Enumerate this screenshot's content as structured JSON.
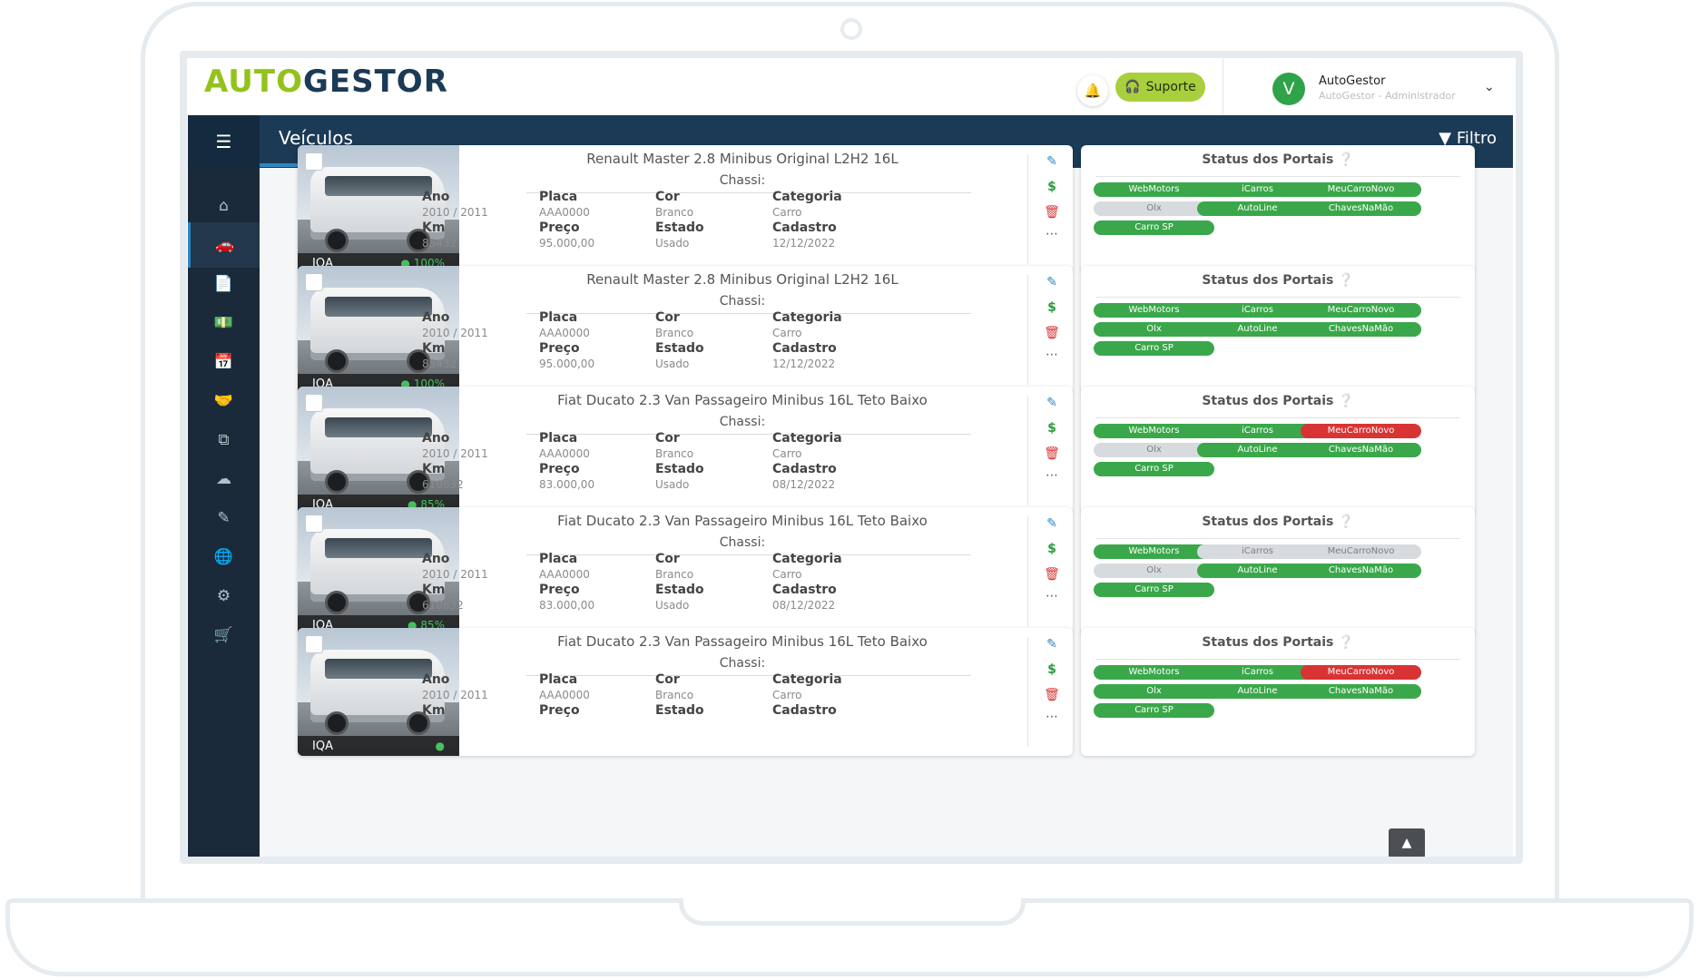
{
  "app": {
    "logo_a": "AUTO",
    "logo_b": "GESTOR"
  },
  "header": {
    "suporte_label": "Suporte",
    "user_initial": "V",
    "user_name": "AutoGestor",
    "user_role": "AutoGestor - Administrador"
  },
  "nav": {
    "page_title": "Veículos",
    "filter_label": "Filtro"
  },
  "sidebar": {
    "items": [
      "home",
      "vehicles",
      "documents",
      "finance",
      "calendar",
      "deals",
      "copy",
      "cloud-upload",
      "edit",
      "globe",
      "settings",
      "cart"
    ],
    "active": "vehicles"
  },
  "labels": {
    "chassi": "Chassi:",
    "ano": "Ano",
    "placa": "Placa",
    "cor": "Cor",
    "categoria": "Categoria",
    "km": "Km",
    "preco": "Preço",
    "estado": "Estado",
    "cadastro": "Cadastro",
    "iqa": "IQA",
    "status_title": "Status dos Portais"
  },
  "vehicles": [
    {
      "title": "Renault Master 2.8 Minibus Original L2H2 16L",
      "ano": "2010 / 2011",
      "placa": "AAA0000",
      "cor": "Branco",
      "categoria": "Carro",
      "km": "85432",
      "preco": "95.000,00",
      "estado": "Usado",
      "cadastro": "12/12/2022",
      "iqa": "100%"
    },
    {
      "title": "Renault Master 2.8 Minibus Original L2H2 16L",
      "ano": "2010 / 2011",
      "placa": "AAA0000",
      "cor": "Branco",
      "categoria": "Carro",
      "km": "85432",
      "preco": "95.000,00",
      "estado": "Usado",
      "cadastro": "12/12/2022",
      "iqa": "100%"
    },
    {
      "title": "Fiat Ducato 2.3 Van Passageiro Minibus 16L Teto Baixo",
      "ano": "2010 / 2011",
      "placa": "AAA0000",
      "cor": "Branco",
      "categoria": "Carro",
      "km": "610632",
      "preco": "83.000,00",
      "estado": "Usado",
      "cadastro": "08/12/2022",
      "iqa": "85%"
    },
    {
      "title": "Fiat Ducato 2.3 Van Passageiro Minibus 16L Teto Baixo",
      "ano": "2010 / 2011",
      "placa": "AAA0000",
      "cor": "Branco",
      "categoria": "Carro",
      "km": "610632",
      "preco": "83.000,00",
      "estado": "Usado",
      "cadastro": "08/12/2022",
      "iqa": "85%"
    },
    {
      "title": "Fiat Ducato 2.3 Van Passageiro Minibus 16L Teto Baixo",
      "ano": "2010 / 2011",
      "placa": "AAA0000",
      "cor": "Branco",
      "categoria": "Carro",
      "km": "",
      "preco": "",
      "estado": "",
      "cadastro": "",
      "iqa": ""
    }
  ],
  "portal_names": [
    "WebMotors",
    "iCarros",
    "MeuCarroNovo",
    "Olx",
    "AutoLine",
    "ChavesNaMão",
    "Carro SP"
  ],
  "portal_status": [
    [
      "on",
      "on",
      "on",
      "off",
      "on",
      "on",
      "on"
    ],
    [
      "on",
      "on",
      "on",
      "on",
      "on",
      "on",
      "on"
    ],
    [
      "on",
      "on",
      "err",
      "off",
      "on",
      "on",
      "on"
    ],
    [
      "on",
      "off",
      "off",
      "off",
      "on",
      "on",
      "on"
    ],
    [
      "on",
      "on",
      "err",
      "on",
      "on",
      "on",
      "on"
    ]
  ],
  "colors": {
    "brand_green": "#94c21d",
    "brand_navy": "#1b3a55",
    "portal_on": "#3aa84a",
    "portal_error": "#d93434",
    "portal_off": "#d8dbde"
  }
}
